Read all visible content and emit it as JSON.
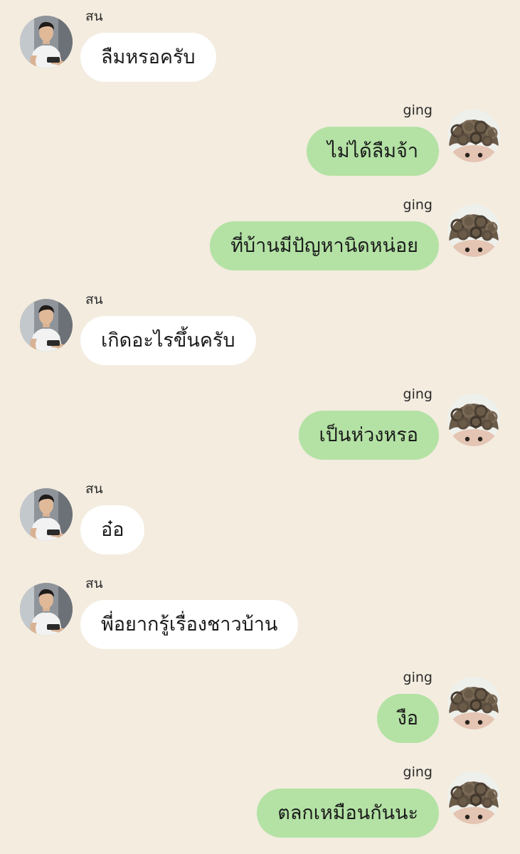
{
  "chat": {
    "messages": [
      {
        "side": "in",
        "sender": "สน",
        "text": "ลืมหรอครับ"
      },
      {
        "side": "out",
        "sender": "ging",
        "text": "ไม่ได้ลืมจ้า"
      },
      {
        "side": "out",
        "sender": "ging",
        "text": "ที่บ้านมีปัญหานิดหน่อย"
      },
      {
        "side": "in",
        "sender": "สน",
        "text": "เกิดอะไรขึ้นครับ"
      },
      {
        "side": "out",
        "sender": "ging",
        "text": "เป็นห่วงหรอ"
      },
      {
        "side": "in",
        "sender": "สน",
        "text": "อ๋อ"
      },
      {
        "side": "in",
        "sender": "สน",
        "text": "พี่อยากรู้เรื่องชาวบ้าน"
      },
      {
        "side": "out",
        "sender": "ging",
        "text": "งือ"
      },
      {
        "side": "out",
        "sender": "ging",
        "text": "ตลกเหมือนกันนะ"
      }
    ]
  },
  "colors": {
    "background": "#f3ecdf",
    "incoming_bubble": "#ffffff",
    "outgoing_bubble": "#b3e2a4"
  },
  "icons": {
    "incoming_avatar": "man-in-white-tank-top-avatar",
    "outgoing_avatar": "curly-hair-peeking-face-avatar"
  }
}
